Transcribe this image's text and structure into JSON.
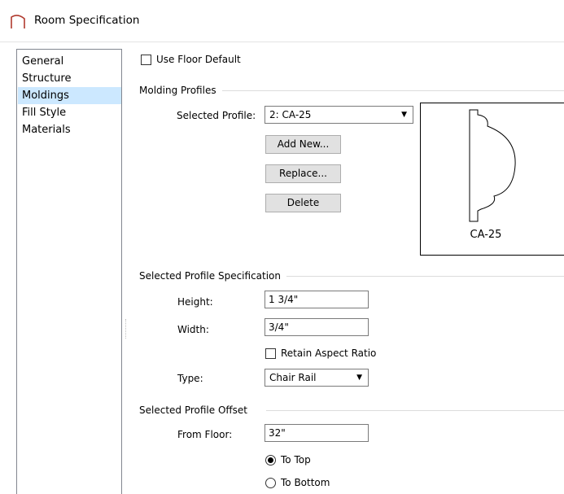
{
  "window": {
    "title": "Room Specification"
  },
  "sidebar": {
    "items": [
      {
        "label": "General"
      },
      {
        "label": "Structure"
      },
      {
        "label": "Moldings",
        "selected": true
      },
      {
        "label": "Fill Style"
      },
      {
        "label": "Materials"
      }
    ]
  },
  "main": {
    "use_floor_default": {
      "label": "Use Floor Default",
      "checked": false
    },
    "molding_profiles": {
      "group_label": "Molding Profiles",
      "selected_profile_label": "Selected Profile:",
      "selected_profile_value": "2:  CA-25",
      "add_new_label": "Add New...",
      "replace_label": "Replace...",
      "delete_label": "Delete",
      "preview_label": "CA-25"
    },
    "spec": {
      "group_label": "Selected Profile Specification",
      "height_label": "Height:",
      "height_value": "1 3/4\"",
      "width_label": "Width:",
      "width_value": "3/4\"",
      "retain_label": "Retain Aspect Ratio",
      "retain_checked": false,
      "type_label": "Type:",
      "type_value": "Chair Rail"
    },
    "offset": {
      "group_label": "Selected Profile Offset",
      "from_floor_label": "From Floor:",
      "from_floor_value": "32\"",
      "to_top_label": "To Top",
      "to_bottom_label": "To Bottom",
      "selected": "To Top"
    }
  },
  "colors": {
    "selection": "#cce8ff",
    "button_face": "#e1e1e1",
    "border": "#7a7a7a",
    "icon": "#c0392b"
  }
}
